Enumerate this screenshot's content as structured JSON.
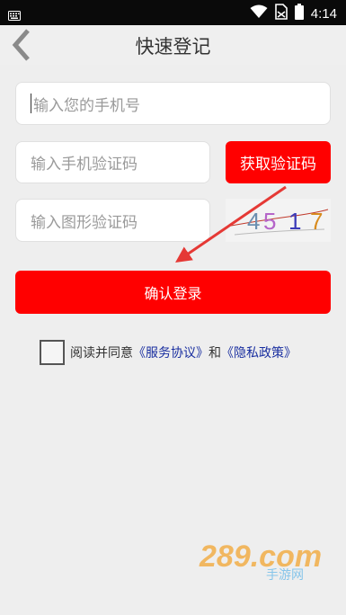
{
  "status_bar": {
    "time": "4:14",
    "icons": [
      "keyboard-icon",
      "wifi-icon",
      "no-sim-icon",
      "battery-icon"
    ]
  },
  "header": {
    "title": "快速登记",
    "back_icon": "chevron-left-icon"
  },
  "form": {
    "phone_placeholder": "输入您的手机号",
    "sms_code_placeholder": "输入手机验证码",
    "image_code_placeholder": "输入图形验证码",
    "get_code_label": "获取验证码",
    "captcha_digits": [
      "4",
      "5",
      "1",
      "7"
    ],
    "captcha_colors": [
      "#6b8fb0",
      "#b565c9",
      "#3b3bb8",
      "#d88b1e"
    ],
    "submit_label": "确认登录"
  },
  "agreement": {
    "prefix": "阅读并同意",
    "service_link": "《服务协议》",
    "and": "和",
    "privacy_link": "《隐私政策》"
  },
  "watermark": {
    "brand": "289.com",
    "sub": "手游网"
  },
  "colors": {
    "accent": "#ff0000",
    "link": "#1a2fa0",
    "background": "#eeeeee"
  }
}
